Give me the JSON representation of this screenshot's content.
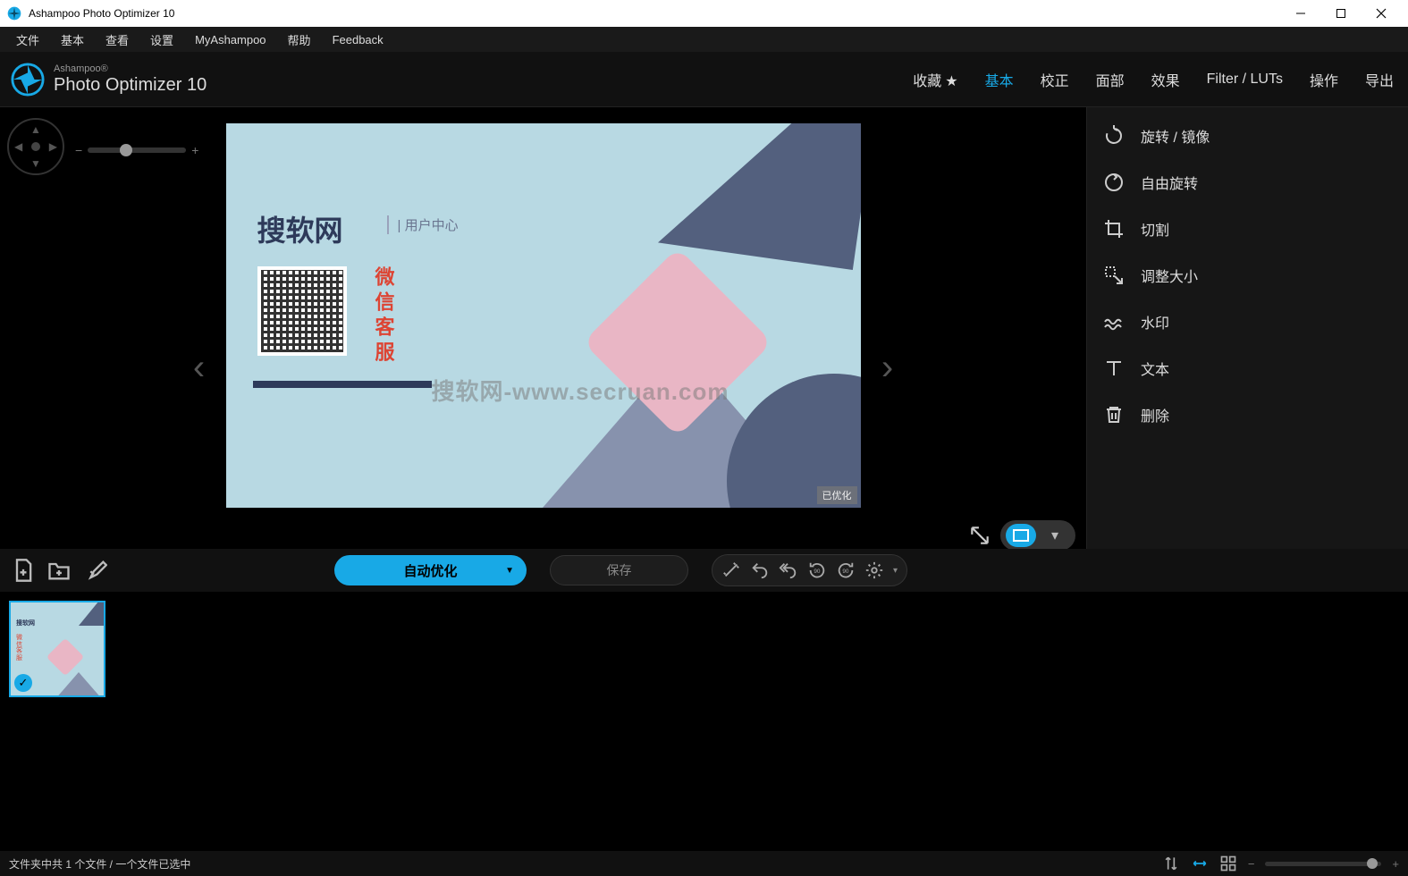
{
  "window": {
    "title": "Ashampoo Photo Optimizer 10"
  },
  "menu": {
    "file": "文件",
    "basic": "基本",
    "view": "查看",
    "settings": "设置",
    "myashampoo": "MyAshampoo",
    "help": "帮助",
    "feedback": "Feedback"
  },
  "header": {
    "brand": "Ashampoo®",
    "product": "Photo Optimizer 10",
    "tabs": {
      "favorites": "收藏",
      "basic": "基本",
      "correction": "校正",
      "face": "面部",
      "effects": "效果",
      "filter": "Filter / LUTs",
      "actions": "操作",
      "export": "导出"
    },
    "active_tab": "basic"
  },
  "canvas": {
    "optimized_badge": "已优化",
    "watermark": "搜软网-www.secruan.com",
    "content": {
      "title": "搜软网",
      "subtitle": "| 用户中心",
      "vertical": "微信客服"
    }
  },
  "sidepanel": {
    "rotate": "旋转 / 镜像",
    "free_rotate": "自由旋转",
    "crop": "切割",
    "resize": "调整大小",
    "watermark": "水印",
    "text": "文本",
    "delete": "删除"
  },
  "actions": {
    "auto_optimize": "自动优化",
    "save": "保存"
  },
  "statusbar": {
    "text": "文件夹中共 1 个文件 / 一个文件已选中"
  }
}
